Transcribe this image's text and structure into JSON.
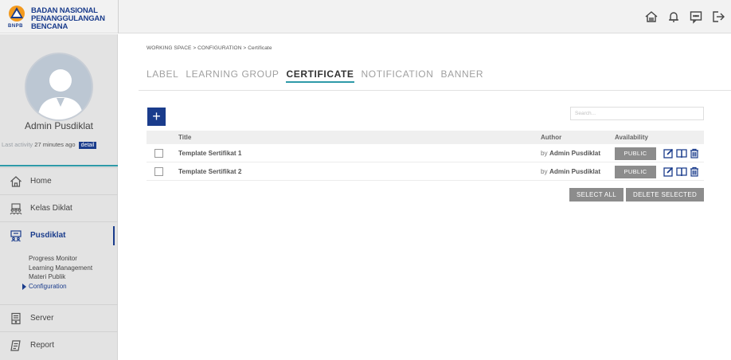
{
  "brand": {
    "line1": "BADAN NASIONAL",
    "line2": "PENANGGULANGAN BENCANA",
    "logo_text": "BNPB",
    "color": "#1a3c8c"
  },
  "topbar": {
    "icons": [
      "home-icon",
      "bell-icon",
      "chat-icon",
      "logout-icon"
    ]
  },
  "profile": {
    "name": "Admin Pusdiklat",
    "last_activity_label": "Last activity",
    "last_activity_value": "27 minutes ago",
    "detail_label": "detail"
  },
  "sidebar": {
    "items": [
      {
        "label": "Home",
        "icon": "home-icon"
      },
      {
        "label": "Kelas Diklat",
        "icon": "classroom-icon"
      },
      {
        "label": "Pusdiklat",
        "icon": "pusdiklat-icon"
      }
    ],
    "submenu": [
      "Progress Monitor",
      "Learning Management",
      "Materi Publik",
      "Configuration"
    ],
    "bottom_items": [
      {
        "label": "Server",
        "icon": "server-icon"
      },
      {
        "label": "Report",
        "icon": "report-icon"
      }
    ]
  },
  "breadcrumb": "WORKING SPACE  >  CONFIGURATION  >  Certificate",
  "tabs": [
    "LABEL",
    "LEARNING GROUP",
    "CERTIFICATE",
    "NOTIFICATION",
    "BANNER"
  ],
  "search": {
    "placeholder": "Search..."
  },
  "table": {
    "headers": {
      "title": "Title",
      "author": "Author",
      "availability": "Availability"
    },
    "rows": [
      {
        "title": "Template Sertifikat 1",
        "author_prefix": "by",
        "author": "Admin Pusdiklat",
        "availability": "PUBLIC"
      },
      {
        "title": "Template Sertifikat 2",
        "author_prefix": "by",
        "author": "Admin Pusdiklat",
        "availability": "PUBLIC"
      }
    ]
  },
  "actions": {
    "add_label": "+",
    "select_all": "SELECT ALL",
    "delete_selected": "DELETE SELECTED"
  },
  "colors": {
    "primary": "#1a3c8c",
    "accent": "#2e9aa8",
    "muted_button": "#8c8c8c"
  }
}
